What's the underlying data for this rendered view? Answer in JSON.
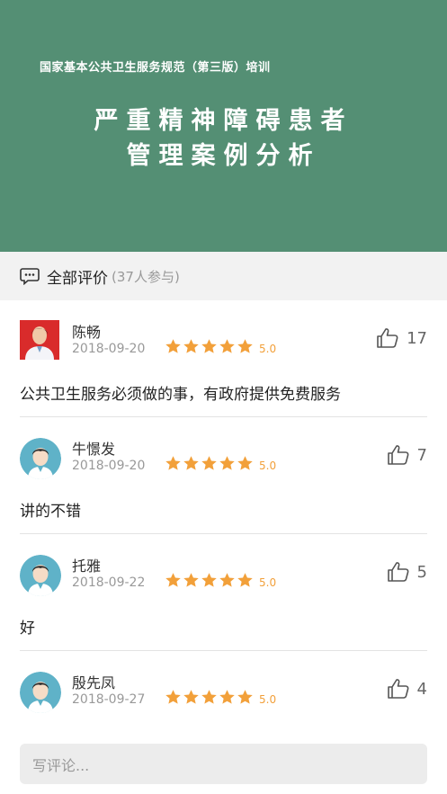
{
  "banner": {
    "subtitle": "国家基本公共卫生服务规范（第三版）培训",
    "title_line1": "严重精神障碍患者",
    "title_line2": "管理案例分析",
    "bg_color": "#548f74"
  },
  "section": {
    "icon": "comment-icon",
    "title": "全部评价",
    "count": "(37人参与)"
  },
  "reviews": [
    {
      "name": "陈畅",
      "date": "2018-09-20",
      "rating": 5,
      "score": "5.0",
      "likes": "17",
      "text": "公共卫生服务必须做的事，有政府提供免费服务",
      "avatar": "photo-avatar"
    },
    {
      "name": "牛憬发",
      "date": "2018-09-20",
      "rating": 5,
      "score": "5.0",
      "likes": "7",
      "text": "讲的不错",
      "avatar": "default-avatar"
    },
    {
      "name": "托雅",
      "date": "2018-09-22",
      "rating": 5,
      "score": "5.0",
      "likes": "5",
      "text": "好",
      "avatar": "default-avatar"
    },
    {
      "name": "殷先凤",
      "date": "2018-09-27",
      "rating": 5,
      "score": "5.0",
      "likes": "4",
      "text": "",
      "avatar": "default-avatar"
    }
  ],
  "input": {
    "placeholder": "写评论..."
  },
  "colors": {
    "star": "#f2a03a",
    "accent": "#548f74"
  }
}
